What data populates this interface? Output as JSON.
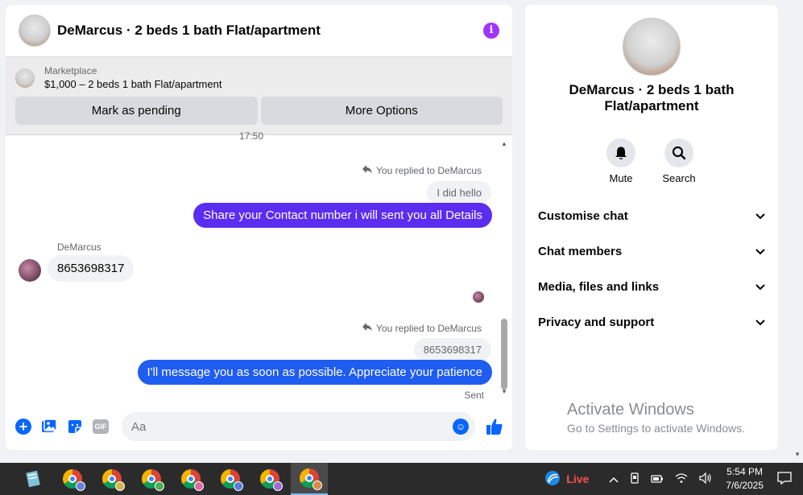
{
  "chat": {
    "title": "DeMarcus · 2 beds 1 bath Flat/apartment",
    "marketplace_label": "Marketplace",
    "listing": "$1,000 – 2 beds 1 bath Flat/apartment",
    "btn_pending": "Mark as pending",
    "btn_more": "More Options"
  },
  "messages": {
    "time_marker": "17:50",
    "reply_note_1": "You replied to DeMarcus",
    "quoted_1": "I did hello",
    "out_1": "Share your Contact number i will sent you all Details",
    "sender_name": "DeMarcus",
    "in_1": "8653698317",
    "reply_note_2": "You replied to DeMarcus",
    "quoted_2": "8653698317",
    "out_2": "I'll message you as soon as possible. Appreciate your patience",
    "sent_status": "Sent"
  },
  "composer": {
    "placeholder": "Aa",
    "gif": "GIF"
  },
  "info": {
    "title": "DeMarcus · 2 beds 1 bath Flat/apartment",
    "mute": "Mute",
    "search": "Search",
    "sections": [
      "Customise chat",
      "Chat members",
      "Media, files and links",
      "Privacy and support"
    ]
  },
  "watermark": {
    "title": "Activate Windows",
    "subtitle": "Go to Settings to activate Windows."
  },
  "taskbar": {
    "live": "Live",
    "time": "5:54 PM",
    "date": "7/6/2025"
  },
  "colors": {
    "out_bubble_1": "#5b2df0",
    "out_bubble_2": "#1f5cf0",
    "accent": "#0866ff",
    "info_icon": "#a033ff"
  }
}
